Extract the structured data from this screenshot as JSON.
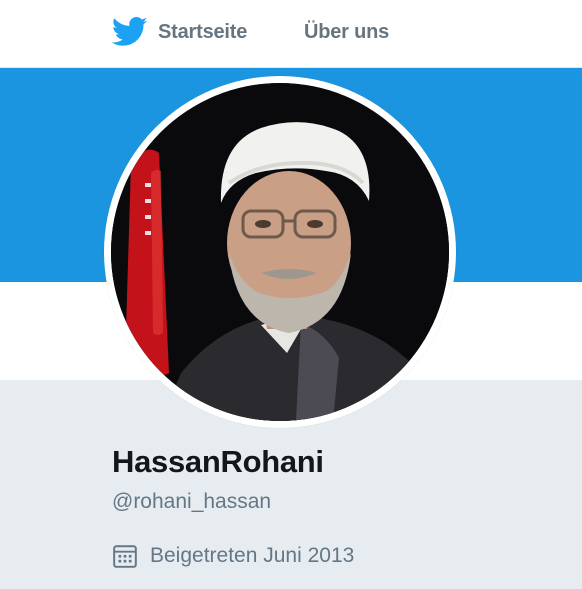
{
  "nav": {
    "home_label": "Startseite",
    "about_label": "Über uns",
    "home_icon": "twitter-bird-icon"
  },
  "colors": {
    "brand_blue": "#1da1f2",
    "banner": "#1b95e0",
    "profile_bg": "#e6ecf0",
    "nav_text": "#66757f",
    "name_text": "#14171a",
    "muted_text": "#657786"
  },
  "profile": {
    "display_name": "HassanRohani",
    "screen_name": "@rohani_hassan",
    "joined_text": "Beigetreten Juni 2013",
    "joined_icon": "calendar-icon",
    "avatar_icon": "profile-photo"
  }
}
